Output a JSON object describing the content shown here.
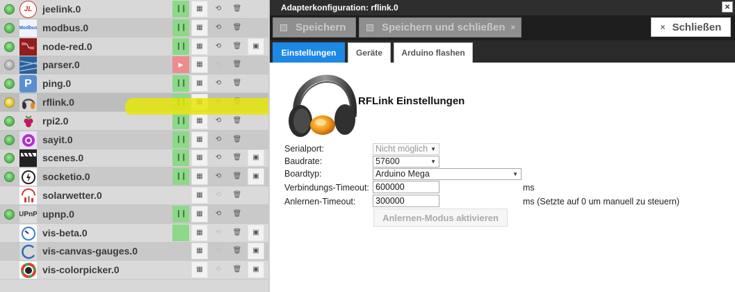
{
  "adapters": [
    {
      "name": "jeelink.0",
      "status": "green",
      "enabled": true,
      "icon": "jeelink-logo"
    },
    {
      "name": "modbus.0",
      "status": "green",
      "enabled": true,
      "icon": "modbus-logo"
    },
    {
      "name": "node-red.0",
      "status": "green",
      "enabled": true,
      "icon": "node-red-logo"
    },
    {
      "name": "parser.0",
      "status": "gray",
      "enabled": false,
      "icon": "parser-logo"
    },
    {
      "name": "ping.0",
      "status": "green",
      "enabled": true,
      "icon": "ping-logo"
    },
    {
      "name": "rflink.0",
      "status": "yellow",
      "enabled": true,
      "icon": "headphones-logo"
    },
    {
      "name": "rpi2.0",
      "status": "green",
      "enabled": true,
      "icon": "raspberry-logo"
    },
    {
      "name": "sayit.0",
      "status": "green",
      "enabled": true,
      "icon": "sayit-logo"
    },
    {
      "name": "scenes.0",
      "status": "green",
      "enabled": true,
      "icon": "clapperboard-logo"
    },
    {
      "name": "socketio.0",
      "status": "green",
      "enabled": true,
      "icon": "socketio-logo"
    },
    {
      "name": "solarwetter.0",
      "status": "none",
      "enabled": false,
      "icon": "solarwetter-logo"
    },
    {
      "name": "upnp.0",
      "status": "green",
      "enabled": true,
      "icon": "upnp-logo"
    },
    {
      "name": "vis-beta.0",
      "status": "none",
      "enabled": false,
      "icon": "gauge-logo"
    },
    {
      "name": "vis-canvas-gauges.0",
      "status": "none",
      "enabled": false,
      "icon": "canvas-gauge-logo"
    },
    {
      "name": "vis-colorpicker.0",
      "status": "none",
      "enabled": false,
      "icon": "colorpicker-logo"
    }
  ],
  "icon_text": {
    "jeelink": "JL",
    "modbus": "Modbus",
    "upnp": "UPnP",
    "ping": "P"
  },
  "dialog": {
    "title": "Adapterkonfiguration: rflink.0",
    "close_x": "×",
    "toolbar": {
      "save": "Speichern",
      "save_close": "Speichern und schließen",
      "close": "Schließen",
      "x": "×"
    },
    "tabs": [
      "Einstellungen",
      "Geräte",
      "Arduino flashen"
    ],
    "heading": "RFLink Einstellungen",
    "fields": {
      "serialport": {
        "label": "Serialport:",
        "value": "Nicht möglich"
      },
      "baudrate": {
        "label": "Baudrate:",
        "value": "57600"
      },
      "boardtyp": {
        "label": "Boardtyp:",
        "value": "Arduino Mega"
      },
      "connect_timeout": {
        "label": "Verbindungs-Timeout:",
        "value": "600000",
        "unit": "ms"
      },
      "learn_timeout": {
        "label": "Anlernen-Timeout:",
        "value": "300000",
        "unit": "ms (Setzte auf 0 um manuell zu steuern)"
      }
    },
    "learn_button": "Anlernen-Modus aktivieren"
  },
  "colors": {
    "accent": "#1e88e5",
    "highlighter": "#e6e60a",
    "led_green": "#5cbc5a",
    "led_yellow": "#d9c62c",
    "running": "#8ed88a",
    "stopped": "#ec8c8c"
  }
}
